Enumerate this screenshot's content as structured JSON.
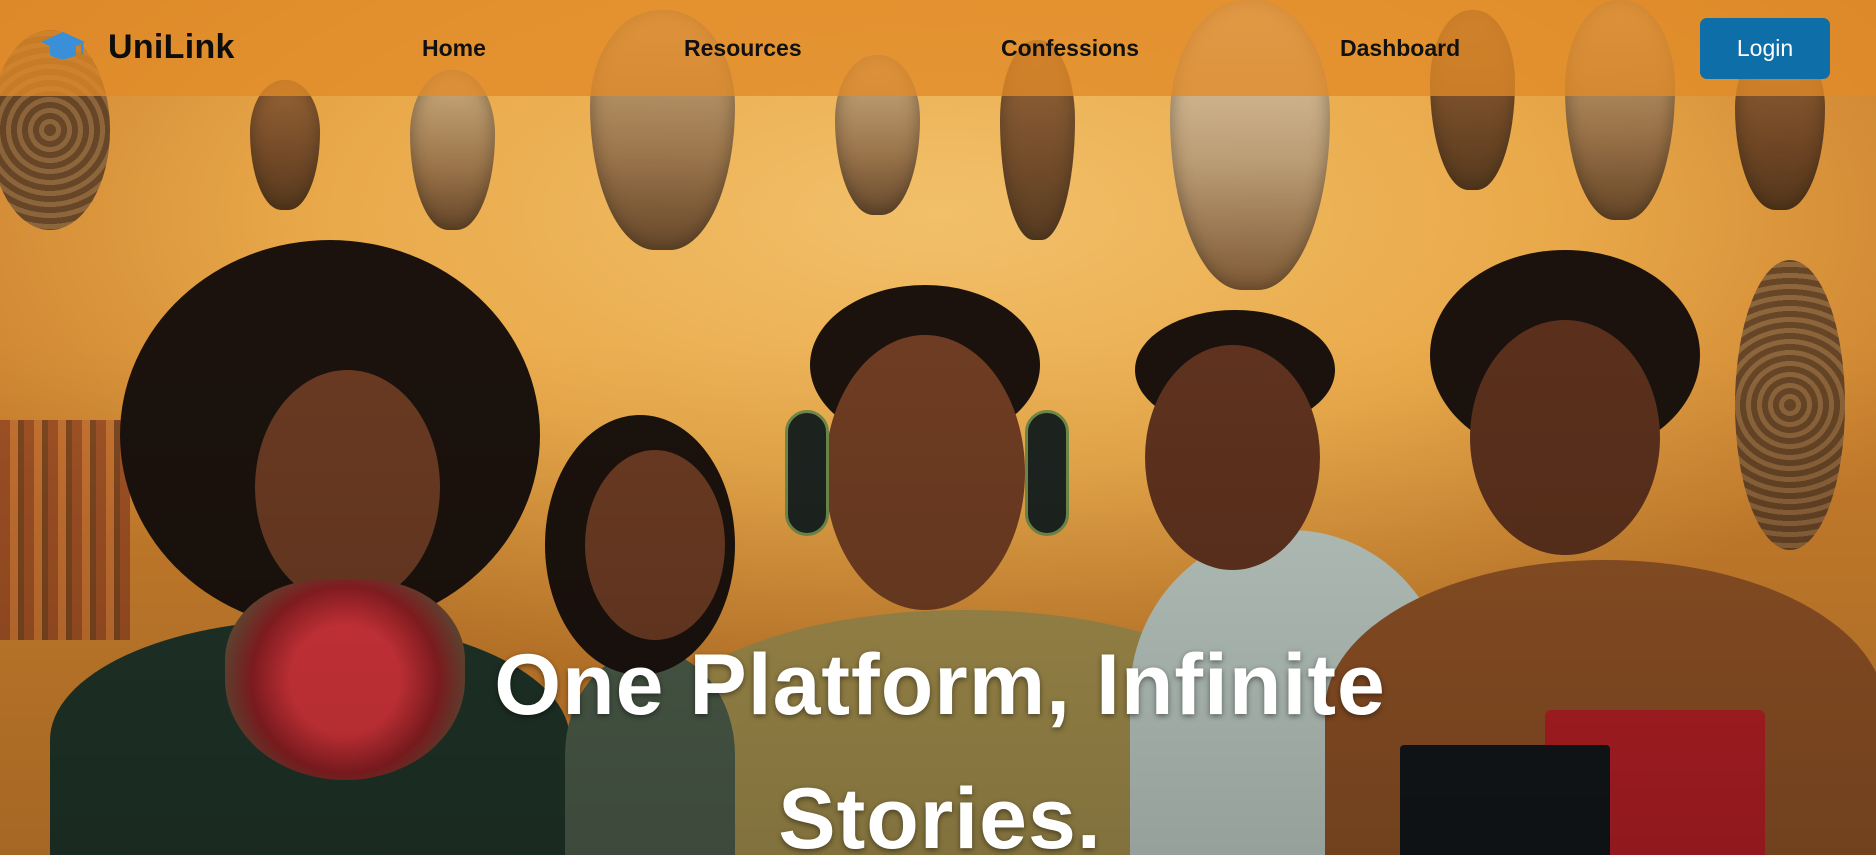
{
  "brand": {
    "name": "UniLink",
    "icon": "graduation-cap-icon",
    "icon_color": "#3a8fd9"
  },
  "nav": {
    "items": [
      {
        "label": "Home"
      },
      {
        "label": "Resources"
      },
      {
        "label": "Confessions"
      },
      {
        "label": "Dashboard"
      }
    ],
    "login_label": "Login",
    "bar_color": "#e28a28",
    "login_color": "#0e6ea7"
  },
  "hero": {
    "headline": "One Platform, Infinite Stories.",
    "background": "photo of smiling students wearing headphones in front of a wall of masks"
  }
}
